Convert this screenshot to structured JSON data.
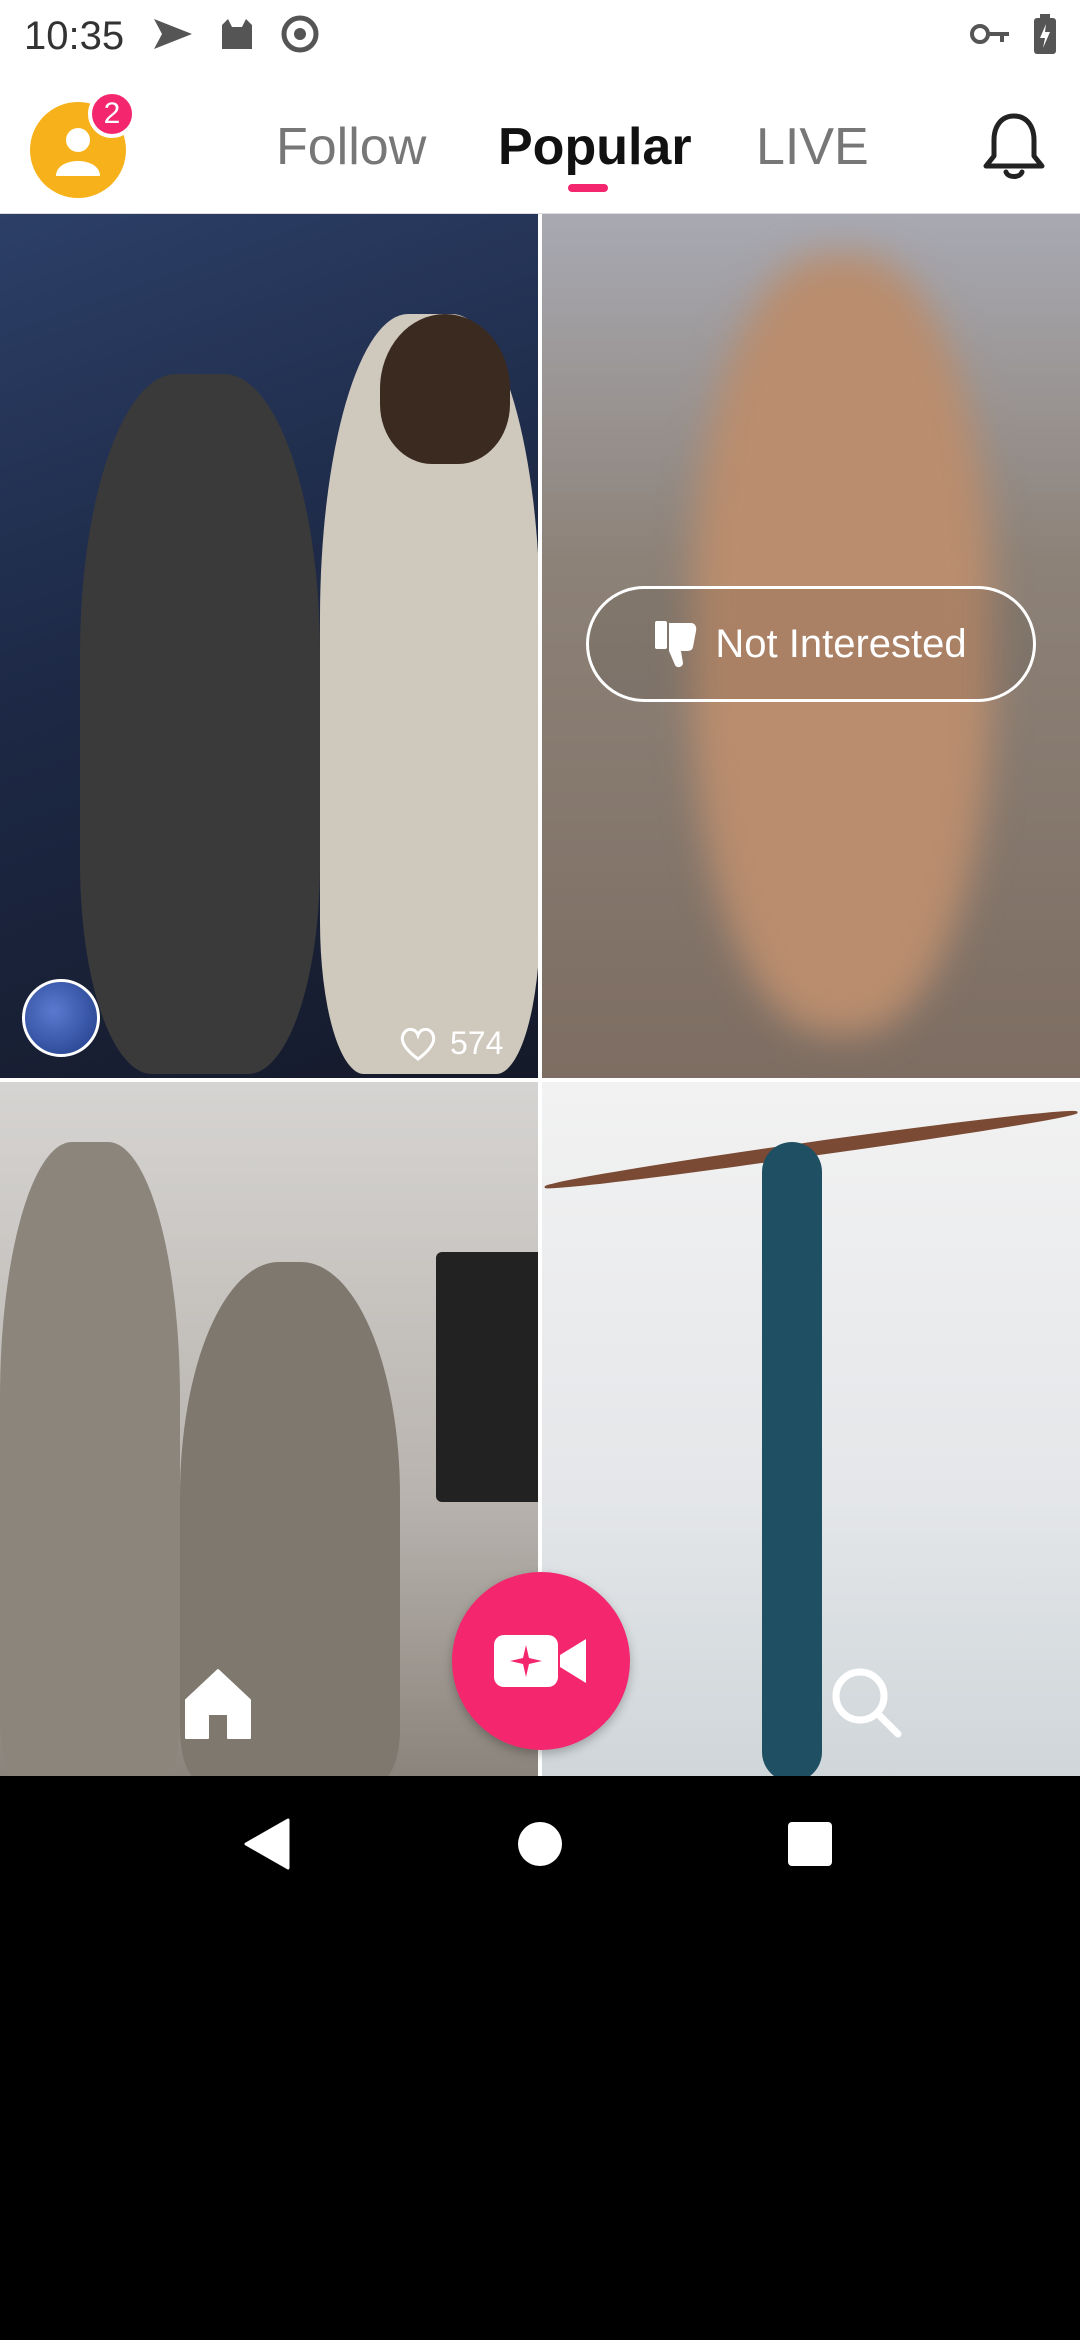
{
  "status_bar": {
    "time": "10:35",
    "icons_left": [
      "send-icon",
      "cat-icon",
      "at-sign-icon"
    ],
    "icons_right": [
      "key-icon",
      "battery-charging-icon"
    ]
  },
  "top_nav": {
    "notification_badge": "2",
    "tabs": [
      {
        "label": "Follow",
        "active": false
      },
      {
        "label": "Popular",
        "active": true
      },
      {
        "label": "LIVE",
        "active": false
      }
    ],
    "accent_color": "#f3266e"
  },
  "feed": {
    "tiles": [
      {
        "likes": "574",
        "has_creator_avatar": true
      },
      {
        "overlay_button": "Not Interested"
      },
      {},
      {}
    ]
  },
  "bottom_nav": {
    "icons": [
      "home-icon",
      "record-video-icon",
      "search-icon"
    ]
  },
  "system_nav": {
    "icons": [
      "back-icon",
      "home-circle-icon",
      "recent-apps-icon"
    ]
  }
}
